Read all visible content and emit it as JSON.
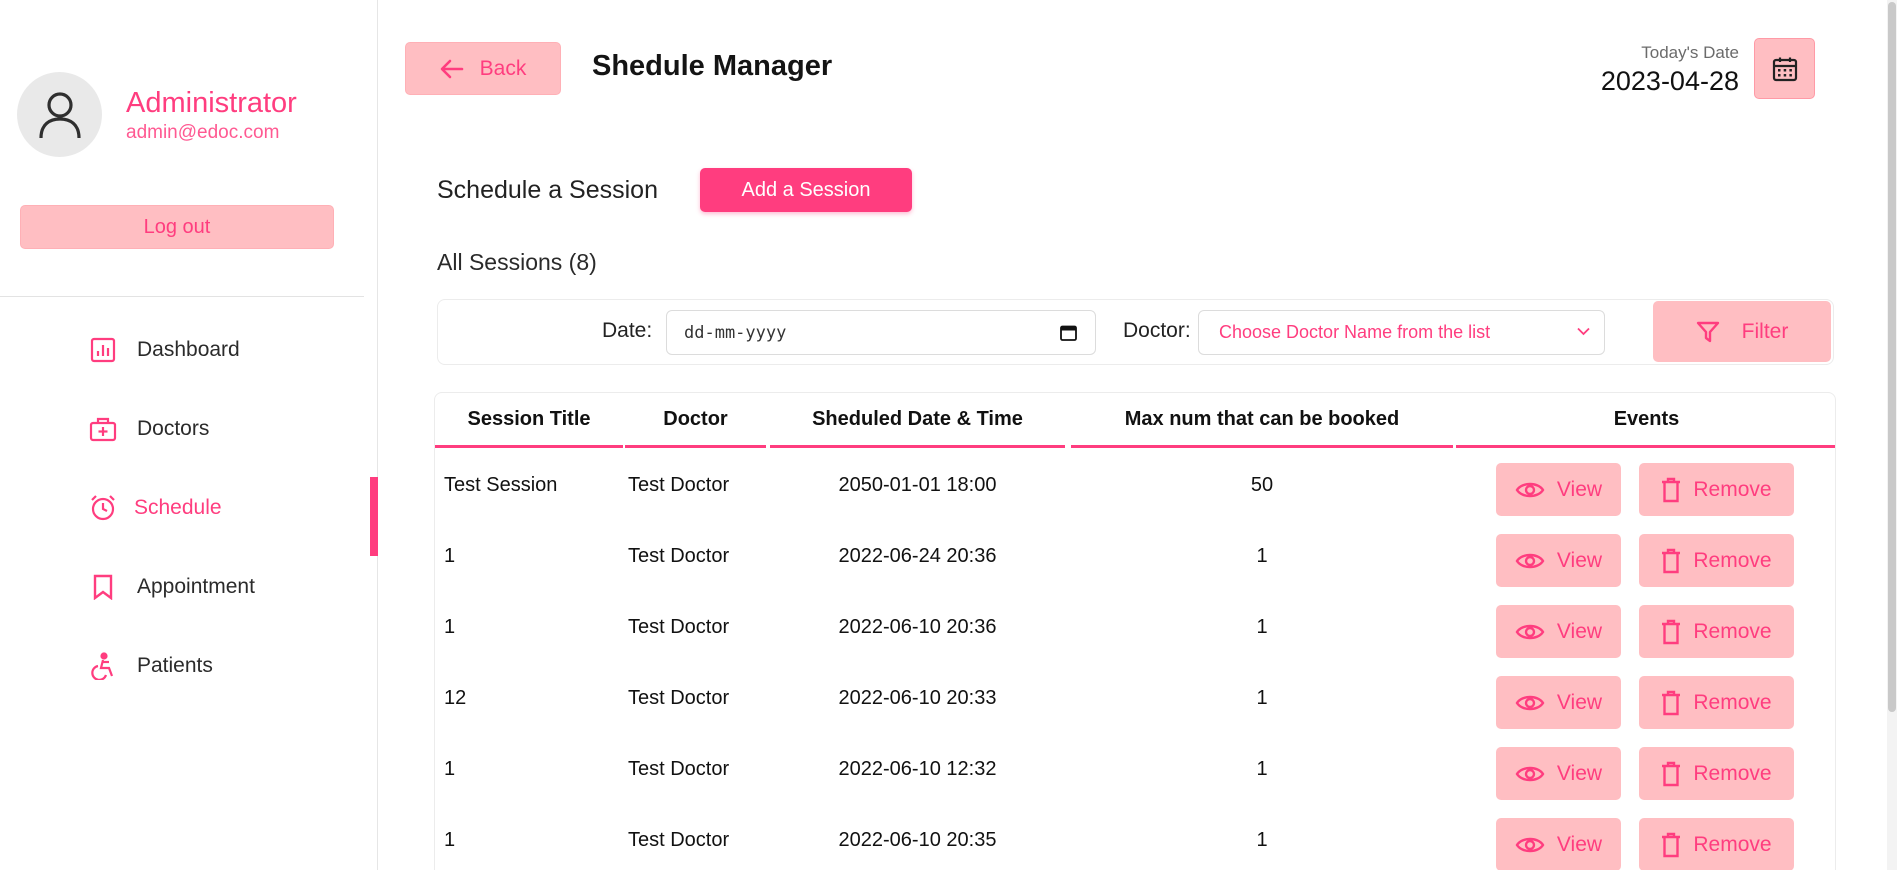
{
  "profile": {
    "name": "Administrator",
    "email": "admin@edoc.com",
    "logout_label": "Log out"
  },
  "sidebar": {
    "items": [
      {
        "label": "Dashboard",
        "icon": "dashboard-icon",
        "active": false
      },
      {
        "label": "Doctors",
        "icon": "doctors-icon",
        "active": false
      },
      {
        "label": "Schedule",
        "icon": "alarm-clock-icon",
        "active": true
      },
      {
        "label": "Appointment",
        "icon": "bookmark-icon",
        "active": false
      },
      {
        "label": "Patients",
        "icon": "accessibility-icon",
        "active": false
      }
    ]
  },
  "header": {
    "back_label": "Back",
    "title": "Shedule Manager",
    "today_label": "Today's Date",
    "today_value": "2023-04-28"
  },
  "sessions": {
    "heading": "Schedule a Session",
    "add_label": "Add a Session",
    "count_label": "All Sessions (8)"
  },
  "filter": {
    "date_label": "Date:",
    "date_placeholder": "dd-mm-yyyy",
    "doctor_label": "Doctor:",
    "doctor_placeholder": "Choose Doctor Name from the list",
    "filter_label": "Filter"
  },
  "table": {
    "columns": [
      "Session Title",
      "Doctor",
      "Sheduled Date & Time",
      "Max num that can be booked",
      "Events"
    ],
    "view_label": "View",
    "remove_label": "Remove",
    "rows": [
      {
        "title": "Test Session",
        "doctor": "Test Doctor",
        "datetime": "2050-01-01 18:00",
        "max": "50"
      },
      {
        "title": "1",
        "doctor": "Test Doctor",
        "datetime": "2022-06-24 20:36",
        "max": "1"
      },
      {
        "title": "1",
        "doctor": "Test Doctor",
        "datetime": "2022-06-10 20:36",
        "max": "1"
      },
      {
        "title": "12",
        "doctor": "Test Doctor",
        "datetime": "2022-06-10 20:33",
        "max": "1"
      },
      {
        "title": "1",
        "doctor": "Test Doctor",
        "datetime": "2022-06-10 12:32",
        "max": "1"
      },
      {
        "title": "1",
        "doctor": "Test Doctor",
        "datetime": "2022-06-10 20:35",
        "max": "1"
      }
    ]
  },
  "colors": {
    "accent": "#ff3d7f",
    "soft": "#ffbec2"
  }
}
